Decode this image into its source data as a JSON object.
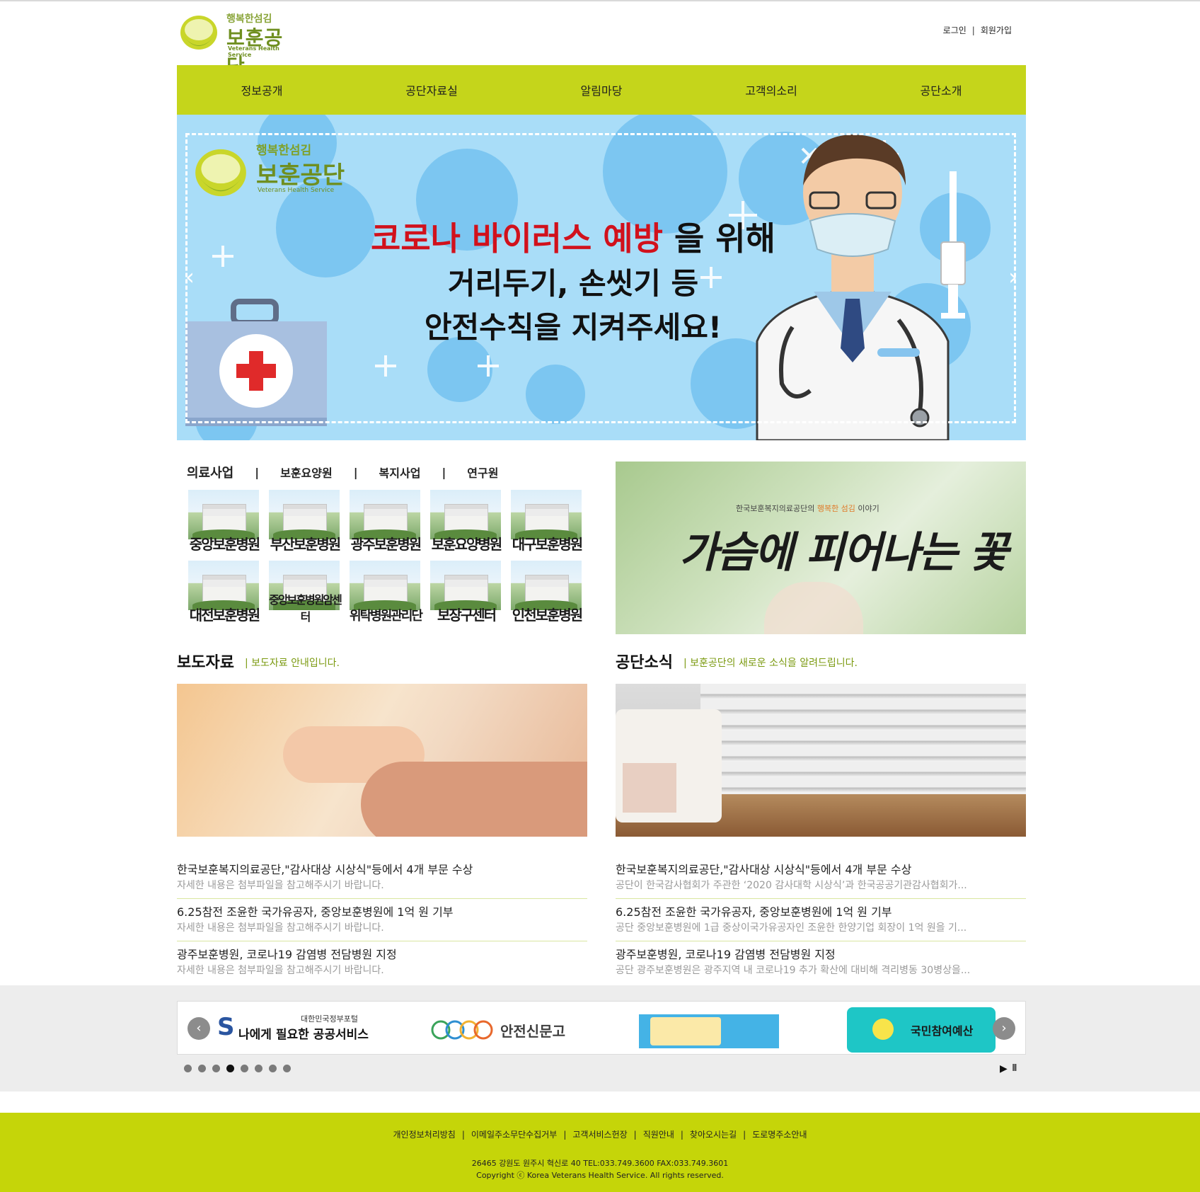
{
  "header": {
    "logo": {
      "slogan": "행복한섬김",
      "name": "보훈공단",
      "english": "Veterans Health Service"
    },
    "auth": {
      "login": "로그인",
      "separator": "|",
      "signup": "회원가입"
    }
  },
  "nav": {
    "items": [
      "정보공개",
      "공단자료실",
      "알림마당",
      "고객의소리",
      "공단소개"
    ]
  },
  "banner": {
    "logo": {
      "slogan": "행복한섬김",
      "name": "보훈공단",
      "english": "Veterans Health Service"
    },
    "line1_highlight": "코로나 바이러스 예방",
    "line1_rest": " 을 위해",
    "line2": "거리두기, 손씻기 등",
    "line3": "안전수칙을 지켜주세요!",
    "prev_arrow": "‹",
    "next_arrow": "›"
  },
  "hospital_tabs": {
    "tabs": [
      "의료사업",
      "보훈요양원",
      "복지사업",
      "연구원"
    ],
    "separator": "|"
  },
  "hospitals": [
    "중앙보훈병원",
    "부산보훈병원",
    "광주보훈병원",
    "보훈요양병원",
    "대구보훈병원",
    "대전보훈병원",
    "중앙보훈병원암센터",
    "위탁병원관리단",
    "보장구센터",
    "인천보훈병원"
  ],
  "flower_banner": {
    "subtitle_pre": "한국보훈복지의료공단의 ",
    "subtitle_highlight": "행복한 섬김",
    "subtitle_post": " 이야기",
    "title": "가슴에 피어나는 꽃"
  },
  "press": {
    "title": "보도자료",
    "subtitle": "| 보도자료 안내입니다.",
    "items": [
      {
        "title": "한국보훈복지의료공단,\"감사대상 시상식\"등에서 4개 부문 수상",
        "desc": "자세한 내용은 첨부파일을 참고해주시기 바랍니다."
      },
      {
        "title": "6.25참전 조윤한 국가유공자, 중앙보훈병원에 1억 원 기부",
        "desc": "자세한 내용은 첨부파일을 참고해주시기 바랍니다."
      },
      {
        "title": "광주보훈병원, 코로나19 감염병 전담병원 지정",
        "desc": "자세한 내용은 첨부파일을 참고해주시기 바랍니다."
      }
    ]
  },
  "news": {
    "title": "공단소식",
    "subtitle": "| 보훈공단의 새로운 소식을 알려드립니다.",
    "items": [
      {
        "title": "한국보훈복지의료공단,\"감사대상 시상식\"등에서 4개 부문 수상",
        "desc": "공단이 한국감사협회가 주관한 ‘2020 감사대학 시상식’과 한국공공기관감사협회가..."
      },
      {
        "title": "6.25참전 조윤한 국가유공자, 중앙보훈병원에 1억 원 기부",
        "desc": "공단 중앙보훈병원에 1급 중상이국가유공자인 조윤한 한양기업 회장이 1억 원을 기..."
      },
      {
        "title": "광주보훈병원, 코로나19 감염병 전담병원 지정",
        "desc": "공단 광주보훈병원은 광주지역 내 코로나19 추가 확산에 대비해 격리병동 30병상을..."
      }
    ]
  },
  "partner_slider": {
    "prev": "‹",
    "next": "›",
    "card1_caption": "대한민국정부포털",
    "card1_main": "나에게 필요한 공공서비스",
    "card2_text": "안전신문고",
    "card4_text": "국민참여예산",
    "dots": 8,
    "active_dot": 3,
    "play": "▶",
    "pause": "II"
  },
  "footer": {
    "links": [
      "개인정보처리방침",
      "이메일주소무단수집거부",
      "고객서비스헌장",
      "직원안내",
      "찾아오시는길",
      "도로명주소안내"
    ],
    "separator": "|",
    "address": "26465 강원도 원주시 혁신로 40 TEL:033.749.3600 FAX:033.749.3601",
    "copyright": "Copyright ⓒ Korea Veterans Health Service. All rights reserved."
  },
  "colors": {
    "accent": "#c5d51b",
    "banner_bg": "#a9ddf8",
    "highlight_red": "#d1111c",
    "subtitle_green": "#7b9a10",
    "footer_bg": "#c5d509"
  }
}
